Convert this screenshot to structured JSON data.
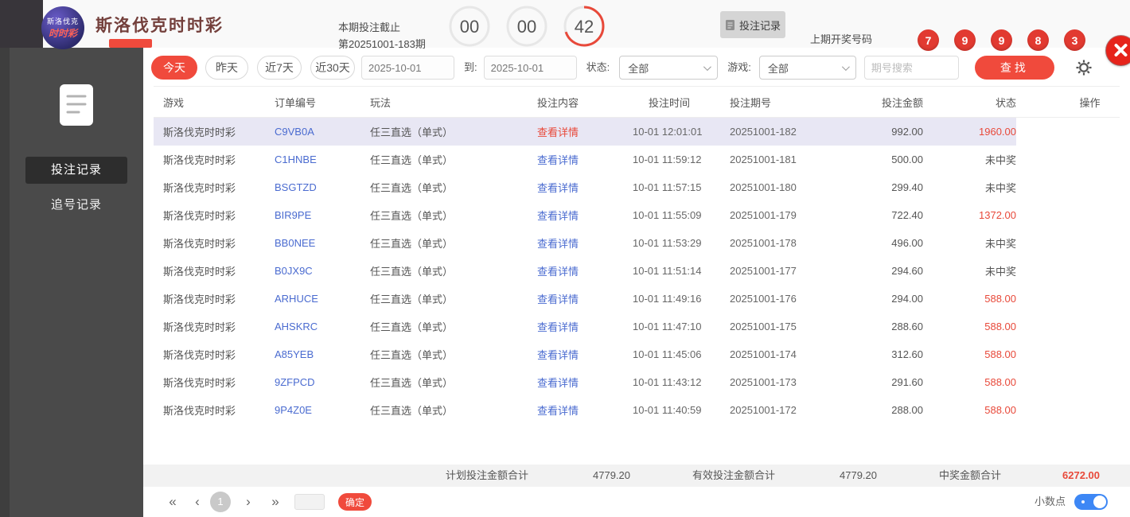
{
  "colors": {
    "accent_red": "#f04a3c",
    "win_red": "#e8493a",
    "link_blue": "#4a6bd0",
    "toggle_blue": "#3d87f5",
    "highlight_row": "#e8e7f4"
  },
  "icons": {
    "first_page": "«",
    "prev_page": "‹",
    "next_page": "›",
    "last_page": "»"
  },
  "page_header": {
    "logo_line1": "斯洛伐克",
    "logo_line2": "时时彩",
    "title": "斯洛伐克时时彩",
    "deadline_label": "本期投注截止",
    "period_label": "第20251001-183期",
    "countdown": {
      "hours": "00",
      "minutes": "00",
      "seconds": "42"
    },
    "bet_records_button": "投注记录",
    "last_draw_label": "上期开奖号码",
    "last_draw_numbers": [
      "7",
      "9",
      "9",
      "8",
      "3"
    ]
  },
  "sidebar": {
    "items": [
      {
        "label": "投注记录",
        "active": true
      },
      {
        "label": "追号记录",
        "active": false
      }
    ]
  },
  "filters": {
    "quick_ranges": [
      "今天",
      "昨天",
      "近7天",
      "近30天"
    ],
    "date_from": "2025-10-01",
    "to_label": "到:",
    "date_to": "2025-10-01",
    "status_label": "状态:",
    "status_value": "全部",
    "game_label": "游戏:",
    "game_value": "全部",
    "search_placeholder": "期号搜索",
    "search_button": "查找"
  },
  "table": {
    "headers": [
      "游戏",
      "订单编号",
      "玩法",
      "投注内容",
      "投注时间",
      "投注期号",
      "投注金额",
      "状态",
      "操作"
    ],
    "detail_link": "查看详情",
    "rows": [
      {
        "game": "斯洛伐克时时彩",
        "order": "C9VB0A",
        "play": "任三直选（单式）",
        "time": "10-01 12:01:01",
        "period": "20251001-182",
        "amount": "992.00",
        "status": "1960.00",
        "win": true,
        "highlight": true
      },
      {
        "game": "斯洛伐克时时彩",
        "order": "C1HNBE",
        "play": "任三直选（单式）",
        "time": "10-01 11:59:12",
        "period": "20251001-181",
        "amount": "500.00",
        "status": "未中奖",
        "win": false,
        "highlight": false
      },
      {
        "game": "斯洛伐克时时彩",
        "order": "BSGTZD",
        "play": "任三直选（单式）",
        "time": "10-01 11:57:15",
        "period": "20251001-180",
        "amount": "299.40",
        "status": "未中奖",
        "win": false,
        "highlight": false
      },
      {
        "game": "斯洛伐克时时彩",
        "order": "BIR9PE",
        "play": "任三直选（单式）",
        "time": "10-01 11:55:09",
        "period": "20251001-179",
        "amount": "722.40",
        "status": "1372.00",
        "win": true,
        "highlight": false
      },
      {
        "game": "斯洛伐克时时彩",
        "order": "BB0NEE",
        "play": "任三直选（单式）",
        "time": "10-01 11:53:29",
        "period": "20251001-178",
        "amount": "496.00",
        "status": "未中奖",
        "win": false,
        "highlight": false
      },
      {
        "game": "斯洛伐克时时彩",
        "order": "B0JX9C",
        "play": "任三直选（单式）",
        "time": "10-01 11:51:14",
        "period": "20251001-177",
        "amount": "294.60",
        "status": "未中奖",
        "win": false,
        "highlight": false
      },
      {
        "game": "斯洛伐克时时彩",
        "order": "ARHUCE",
        "play": "任三直选（单式）",
        "time": "10-01 11:49:16",
        "period": "20251001-176",
        "amount": "294.00",
        "status": "588.00",
        "win": true,
        "highlight": false
      },
      {
        "game": "斯洛伐克时时彩",
        "order": "AHSKRC",
        "play": "任三直选（单式）",
        "time": "10-01 11:47:10",
        "period": "20251001-175",
        "amount": "288.60",
        "status": "588.00",
        "win": true,
        "highlight": false
      },
      {
        "game": "斯洛伐克时时彩",
        "order": "A85YEB",
        "play": "任三直选（单式）",
        "time": "10-01 11:45:06",
        "period": "20251001-174",
        "amount": "312.60",
        "status": "588.00",
        "win": true,
        "highlight": false
      },
      {
        "game": "斯洛伐克时时彩",
        "order": "9ZFPCD",
        "play": "任三直选（单式）",
        "time": "10-01 11:43:12",
        "period": "20251001-173",
        "amount": "291.60",
        "status": "588.00",
        "win": true,
        "highlight": false
      },
      {
        "game": "斯洛伐克时时彩",
        "order": "9P4Z0E",
        "play": "任三直选（单式）",
        "time": "10-01 11:40:59",
        "period": "20251001-172",
        "amount": "288.00",
        "status": "588.00",
        "win": true,
        "highlight": false
      }
    ]
  },
  "summary": {
    "plan_total_label": "计划投注金额合计",
    "plan_total": "4779.20",
    "valid_total_label": "有效投注金额合计",
    "valid_total": "4779.20",
    "win_total_label": "中奖金额合计",
    "win_total": "6272.00"
  },
  "pagination": {
    "current_page": "1",
    "confirm_button": "确定",
    "decimal_label": "小数点"
  }
}
